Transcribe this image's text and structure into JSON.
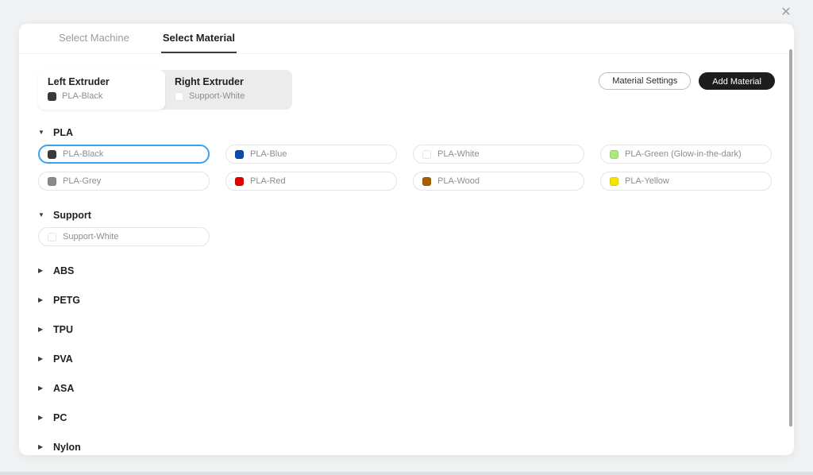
{
  "window": {
    "close_icon": "✕"
  },
  "tabs": [
    {
      "label": "Select Machine",
      "active": false
    },
    {
      "label": "Select Material",
      "active": true
    }
  ],
  "extruders": {
    "left": {
      "title": "Left Extruder",
      "material": "PLA-Black",
      "color": "#3a3a3a"
    },
    "right": {
      "title": "Right Extruder",
      "material": "Support-White",
      "color": "#ffffff"
    }
  },
  "toolbar": {
    "material_settings_label": "Material Settings",
    "add_material_label": "Add Material"
  },
  "sections": [
    {
      "name": "PLA",
      "expanded": true,
      "materials": [
        {
          "label": "PLA-Black",
          "color": "#3a3a3a",
          "selected": true
        },
        {
          "label": "PLA-Blue",
          "color": "#0a4dad",
          "selected": false
        },
        {
          "label": "PLA-White",
          "color": "#ffffff",
          "selected": false
        },
        {
          "label": "PLA-Green (Glow-in-the-dark)",
          "color": "#abe87d",
          "selected": false
        },
        {
          "label": "PLA-Grey",
          "color": "#8a8a8a",
          "selected": false
        },
        {
          "label": "PLA-Red",
          "color": "#e00000",
          "selected": false
        },
        {
          "label": "PLA-Wood",
          "color": "#a65e00",
          "selected": false
        },
        {
          "label": "PLA-Yellow",
          "color": "#f5e500",
          "selected": false
        }
      ]
    },
    {
      "name": "Support",
      "expanded": true,
      "materials": [
        {
          "label": "Support-White",
          "color": "#ffffff",
          "selected": false
        }
      ]
    },
    {
      "name": "ABS",
      "expanded": false
    },
    {
      "name": "PETG",
      "expanded": false
    },
    {
      "name": "TPU",
      "expanded": false
    },
    {
      "name": "PVA",
      "expanded": false
    },
    {
      "name": "ASA",
      "expanded": false
    },
    {
      "name": "PC",
      "expanded": false
    },
    {
      "name": "Nylon",
      "expanded": false
    }
  ],
  "carets": {
    "expanded": "▼",
    "collapsed": "▶"
  },
  "colors": {
    "accent": "#35a3f1",
    "selected_border": "#35a3f1"
  }
}
